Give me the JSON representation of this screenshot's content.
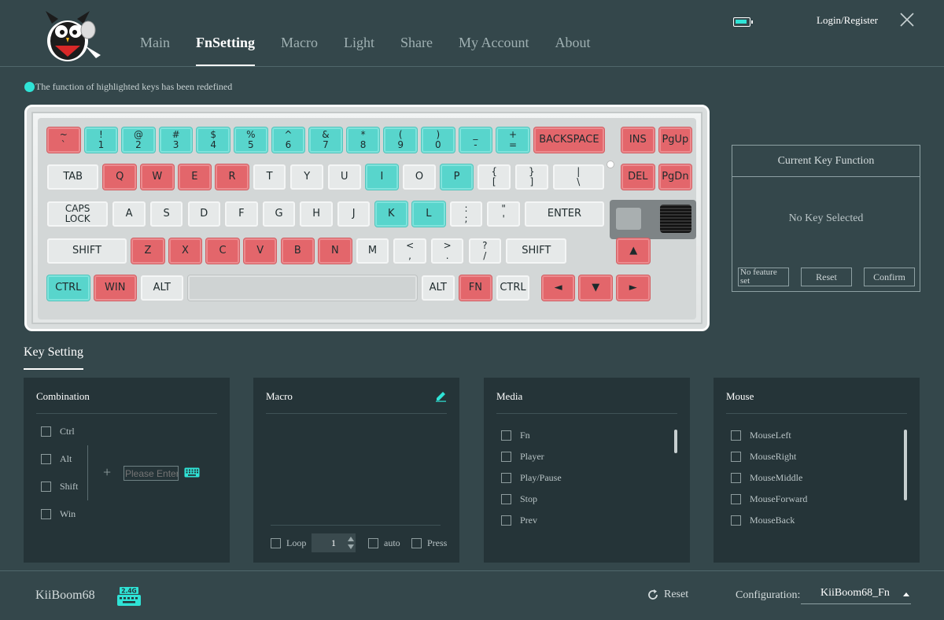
{
  "header": {
    "tabs": [
      {
        "label": "Main",
        "active": false
      },
      {
        "label": "FnSetting",
        "active": true
      },
      {
        "label": "Macro",
        "active": false
      },
      {
        "label": "Light",
        "active": false
      },
      {
        "label": "Share",
        "active": false
      },
      {
        "label": "My Account",
        "active": false
      },
      {
        "label": "About",
        "active": false
      }
    ],
    "login_label": "Login/Register",
    "battery_icon": "battery-icon",
    "close_icon": "close-icon"
  },
  "notice": "The function of highlighted keys has been redefined",
  "colors": {
    "accent": "#2fe3d6",
    "key_red": "#e3666b",
    "key_cyan": "#58d5cc",
    "key_normal": "#e6e9e9",
    "background": "#34474b",
    "panel": "#253438"
  },
  "keyboard": {
    "rows": [
      [
        {
          "label": "~\n`",
          "color": "r"
        },
        {
          "label": "!\n1",
          "color": "c"
        },
        {
          "label": "@\n2",
          "color": "c"
        },
        {
          "label": "#\n3",
          "color": "c"
        },
        {
          "label": "$\n4",
          "color": "c"
        },
        {
          "label": "%\n5",
          "color": "c"
        },
        {
          "label": "^\n6",
          "color": "c"
        },
        {
          "label": "&\n7",
          "color": "c"
        },
        {
          "label": "*\n8",
          "color": "c"
        },
        {
          "label": "(\n9",
          "color": "c"
        },
        {
          "label": ")\n0",
          "color": "c"
        },
        {
          "label": "_\n-",
          "color": "c"
        },
        {
          "label": "+\n=",
          "color": "c"
        },
        {
          "label": "BACKSPACE",
          "color": "r"
        },
        {
          "label": "INS",
          "color": "r"
        },
        {
          "label": "PgUp",
          "color": "r"
        }
      ],
      [
        {
          "label": "TAB",
          "color": "n"
        },
        {
          "label": "Q",
          "color": "r"
        },
        {
          "label": "W",
          "color": "r"
        },
        {
          "label": "E",
          "color": "r"
        },
        {
          "label": "R",
          "color": "r"
        },
        {
          "label": "T",
          "color": "n"
        },
        {
          "label": "Y",
          "color": "n"
        },
        {
          "label": "U",
          "color": "n"
        },
        {
          "label": "I",
          "color": "c"
        },
        {
          "label": "O",
          "color": "n"
        },
        {
          "label": "P",
          "color": "c"
        },
        {
          "label": "{\n[",
          "color": "n"
        },
        {
          "label": "}\n]",
          "color": "n"
        },
        {
          "label": "|\n\\",
          "color": "n"
        },
        {
          "label": "DEL",
          "color": "r"
        },
        {
          "label": "PgDn",
          "color": "r"
        }
      ],
      [
        {
          "label": "CAPS\nLOCK",
          "color": "n"
        },
        {
          "label": "A",
          "color": "n"
        },
        {
          "label": "S",
          "color": "n"
        },
        {
          "label": "D",
          "color": "n"
        },
        {
          "label": "F",
          "color": "n"
        },
        {
          "label": "G",
          "color": "n"
        },
        {
          "label": "H",
          "color": "n"
        },
        {
          "label": "J",
          "color": "n"
        },
        {
          "label": "K",
          "color": "c"
        },
        {
          "label": "L",
          "color": "c"
        },
        {
          "label": ":\n;",
          "color": "n"
        },
        {
          "label": "\"\n'",
          "color": "n"
        },
        {
          "label": "ENTER",
          "color": "n"
        }
      ],
      [
        {
          "label": "SHIFT",
          "color": "n"
        },
        {
          "label": "Z",
          "color": "r"
        },
        {
          "label": "X",
          "color": "r"
        },
        {
          "label": "C",
          "color": "r"
        },
        {
          "label": "V",
          "color": "r"
        },
        {
          "label": "B",
          "color": "r"
        },
        {
          "label": "N",
          "color": "r"
        },
        {
          "label": "M",
          "color": "n"
        },
        {
          "label": "<\n,",
          "color": "n"
        },
        {
          "label": ">\n.",
          "color": "n"
        },
        {
          "label": "?\n/",
          "color": "n"
        },
        {
          "label": "SHIFT",
          "color": "n"
        },
        {
          "label": "▲",
          "color": "r"
        }
      ],
      [
        {
          "label": "CTRL",
          "color": "c"
        },
        {
          "label": "WIN",
          "color": "r"
        },
        {
          "label": "ALT",
          "color": "n"
        },
        {
          "label": "",
          "color": "n"
        },
        {
          "label": "ALT",
          "color": "n"
        },
        {
          "label": "FN",
          "color": "r"
        },
        {
          "label": "CTRL",
          "color": "n"
        },
        {
          "label": "◄",
          "color": "r"
        },
        {
          "label": "▼",
          "color": "r"
        },
        {
          "label": "►",
          "color": "r"
        }
      ]
    ]
  },
  "current_key": {
    "title": "Current Key Function",
    "status": "No Key Selected",
    "feature_label": "No feature set",
    "reset_label": "Reset",
    "confirm_label": "Confirm"
  },
  "key_setting": {
    "title": "Key Setting",
    "combination": {
      "title": "Combination",
      "modifiers": [
        "Ctrl",
        "Alt",
        "Shift",
        "Win"
      ],
      "placeholder": "Please Enter",
      "plus": "+",
      "keyboard_icon": "keyboard-icon"
    },
    "macro": {
      "title": "Macro",
      "edit_icon": "edit-icon",
      "loop_label": "Loop",
      "loop_value": "1",
      "auto_label": "auto",
      "press_label": "Press"
    },
    "media": {
      "title": "Media",
      "items": [
        "Fn",
        "Player",
        "Play/Pause",
        "Stop",
        "Prev"
      ]
    },
    "mouse": {
      "title": "Mouse",
      "items": [
        "MouseLeft",
        "MouseRight",
        "MouseMiddle",
        "MouseForward",
        "MouseBack"
      ]
    }
  },
  "footer": {
    "device_name": "KiiBoom68",
    "dongle_label": "2.4G",
    "reset_label": "Reset",
    "config_label": "Configuration:",
    "config_value": "KiiBoom68_Fn"
  }
}
